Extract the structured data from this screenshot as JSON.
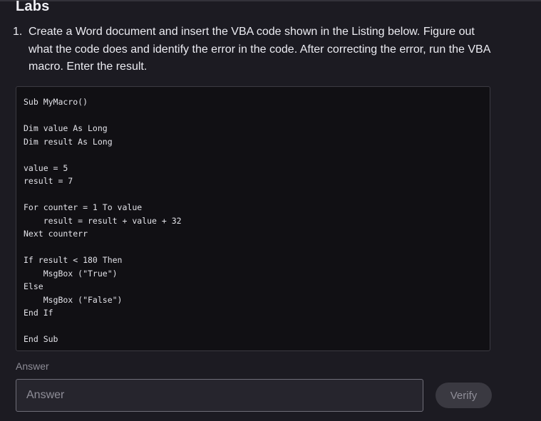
{
  "page": {
    "title": "Labs"
  },
  "question": {
    "number": "1.",
    "text": "Create a Word document and insert the VBA code shown in the Listing below. Figure out what the code does and identify the error in the code. After correcting the error, run the VBA macro. Enter the result."
  },
  "code": {
    "listing": "Sub MyMacro()\n\nDim value As Long\nDim result As Long\n\nvalue = 5\nresult = 7\n\nFor counter = 1 To value\n    result = result + value + 32\nNext counterr\n\nIf result < 180 Then\n    MsgBox (\"True\")\nElse\n    MsgBox (\"False\")\nEnd If\n\nEnd Sub"
  },
  "answer": {
    "label": "Answer",
    "placeholder": "Answer",
    "value": ""
  },
  "verify": {
    "label": "Verify"
  },
  "colors": {
    "background": "#1c1b22",
    "code_background": "#111014",
    "input_background": "#26252d",
    "button_background": "#3a3941",
    "muted_text": "#8f8e98"
  }
}
